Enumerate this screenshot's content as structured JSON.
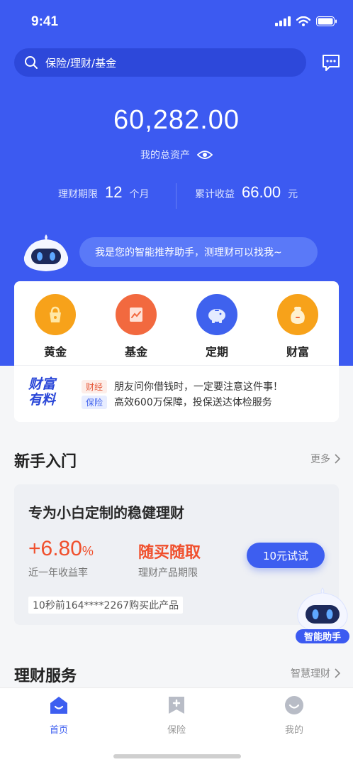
{
  "status_bar": {
    "time": "9:41"
  },
  "search": {
    "placeholder": "保险/理财/基金"
  },
  "assets": {
    "total": "60,282.00",
    "total_label": "我的总资产",
    "term_label": "理财期限",
    "term_value": "12",
    "term_unit": "个月",
    "income_label": "累计收益",
    "income_value": "66.00",
    "income_unit": "元"
  },
  "assistant_bubble": "我是您的智能推荐助手，测理财可以找我~",
  "categories": [
    {
      "label": "黄金",
      "icon": "gold-bag-icon",
      "color": "#f7a21a"
    },
    {
      "label": "基金",
      "icon": "fund-chart-icon",
      "color": "#f2693f"
    },
    {
      "label": "定期",
      "icon": "piggy-bank-icon",
      "color": "#3f62ee"
    },
    {
      "label": "财富",
      "icon": "money-bag-icon",
      "color": "#f7a21a"
    }
  ],
  "news": {
    "logo_line1": "财富",
    "logo_line2": "有料",
    "items": [
      {
        "tag": "财经",
        "text": "朋友问你借钱时，一定要注意这件事！"
      },
      {
        "tag": "保险",
        "text": "高效600万保障，投保送达体检服务"
      }
    ]
  },
  "newbie": {
    "title": "新手入门",
    "more": "更多",
    "product": {
      "title": "专为小白定制的稳健理财",
      "rate": "+6.80",
      "rate_unit": "%",
      "rate_label": "近一年收益率",
      "term": "随买随取",
      "term_label": "理财产品期限",
      "button": "10元试试",
      "buy_note": "10秒前164****2267购买此产品"
    }
  },
  "assistant_badge": "智能助手",
  "services": {
    "title": "理财服务",
    "more": "智慧理财"
  },
  "tabbar": [
    {
      "label": "首页",
      "icon": "home-icon",
      "active": true
    },
    {
      "label": "保险",
      "icon": "insurance-icon",
      "active": false
    },
    {
      "label": "我的",
      "icon": "profile-icon",
      "active": false
    }
  ],
  "colors": {
    "primary": "#3c5af1",
    "accent_red": "#f0502d"
  }
}
